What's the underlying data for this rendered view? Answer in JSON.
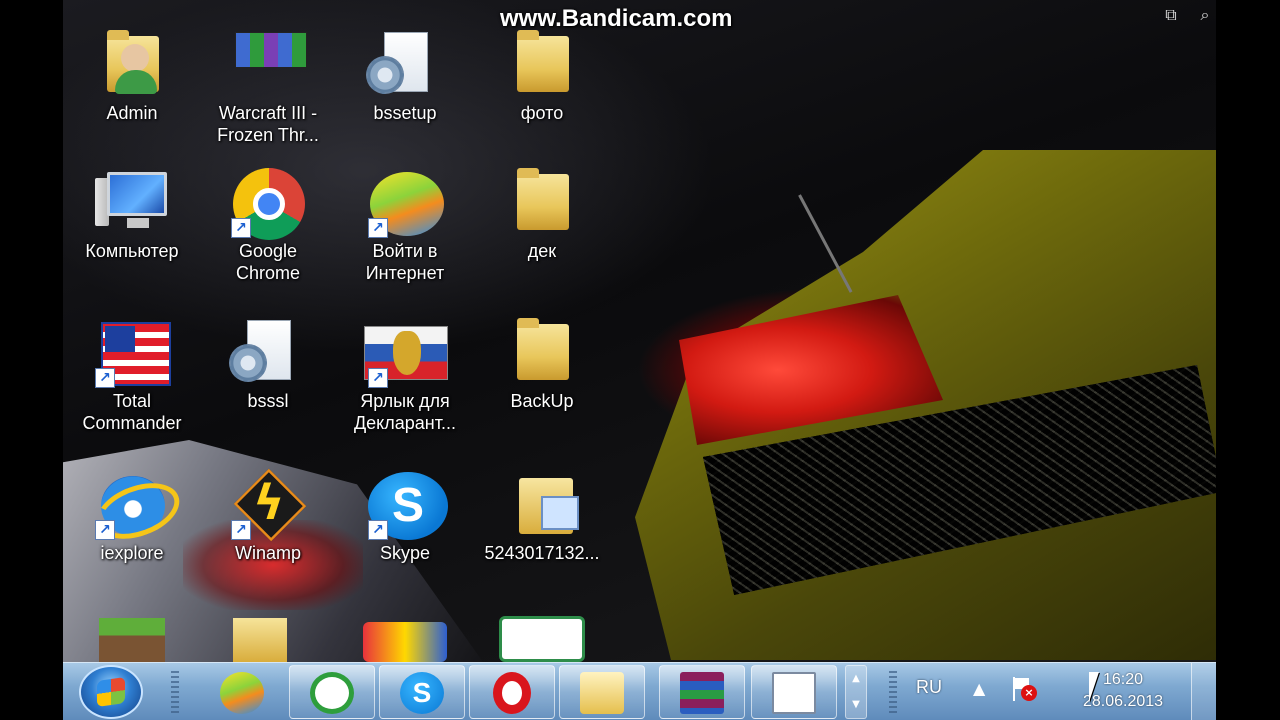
{
  "watermark": {
    "text": "www.Bandicam.com"
  },
  "desktop_icons": [
    {
      "label": "Admin",
      "icon": "user-folder-icon"
    },
    {
      "label": "Warcraft III - Frozen Thr...",
      "icon": "archive-books-icon",
      "shortcut": true
    },
    {
      "label": "bssetup",
      "icon": "settings-file-icon"
    },
    {
      "label": "фото",
      "icon": "folder-icon"
    },
    {
      "label": "Компьютер",
      "icon": "computer-icon"
    },
    {
      "label": "Google Chrome",
      "icon": "chrome-icon",
      "shortcut": true
    },
    {
      "label": "Войти в Интернет",
      "icon": "internet-swirl-icon",
      "shortcut": true
    },
    {
      "label": "дек",
      "icon": "folder-icon"
    },
    {
      "label": "Total Commander",
      "icon": "floppy-icon",
      "shortcut": true
    },
    {
      "label": "bsssl",
      "icon": "settings-file-icon"
    },
    {
      "label": "Ярлык для Декларант...",
      "icon": "emblem-icon",
      "shortcut": true
    },
    {
      "label": "BackUp",
      "icon": "folder-icon"
    },
    {
      "label": "iexplore",
      "icon": "internet-explorer-icon",
      "shortcut": true
    },
    {
      "label": "Winamp",
      "icon": "winamp-icon",
      "shortcut": true
    },
    {
      "label": "Skype",
      "icon": "skype-icon",
      "shortcut": true
    },
    {
      "label": "5243017132...",
      "icon": "file-stack-icon"
    }
  ],
  "taskbar": {
    "pinned": [
      {
        "name": "internet-swirl-icon"
      },
      {
        "name": "mail-agent-icon"
      },
      {
        "name": "skype-icon"
      },
      {
        "name": "opera-icon"
      },
      {
        "name": "explorer-folder-icon"
      },
      {
        "name": "winrar-icon"
      },
      {
        "name": "notepad-window-icon"
      }
    ],
    "tray": {
      "language": "RU",
      "time": "16:20",
      "date": "28.06.2013"
    }
  },
  "colors": {
    "taskbar": "#7fa9d1",
    "accent_red": "#d21a12",
    "car_yellow": "#9c9415"
  }
}
